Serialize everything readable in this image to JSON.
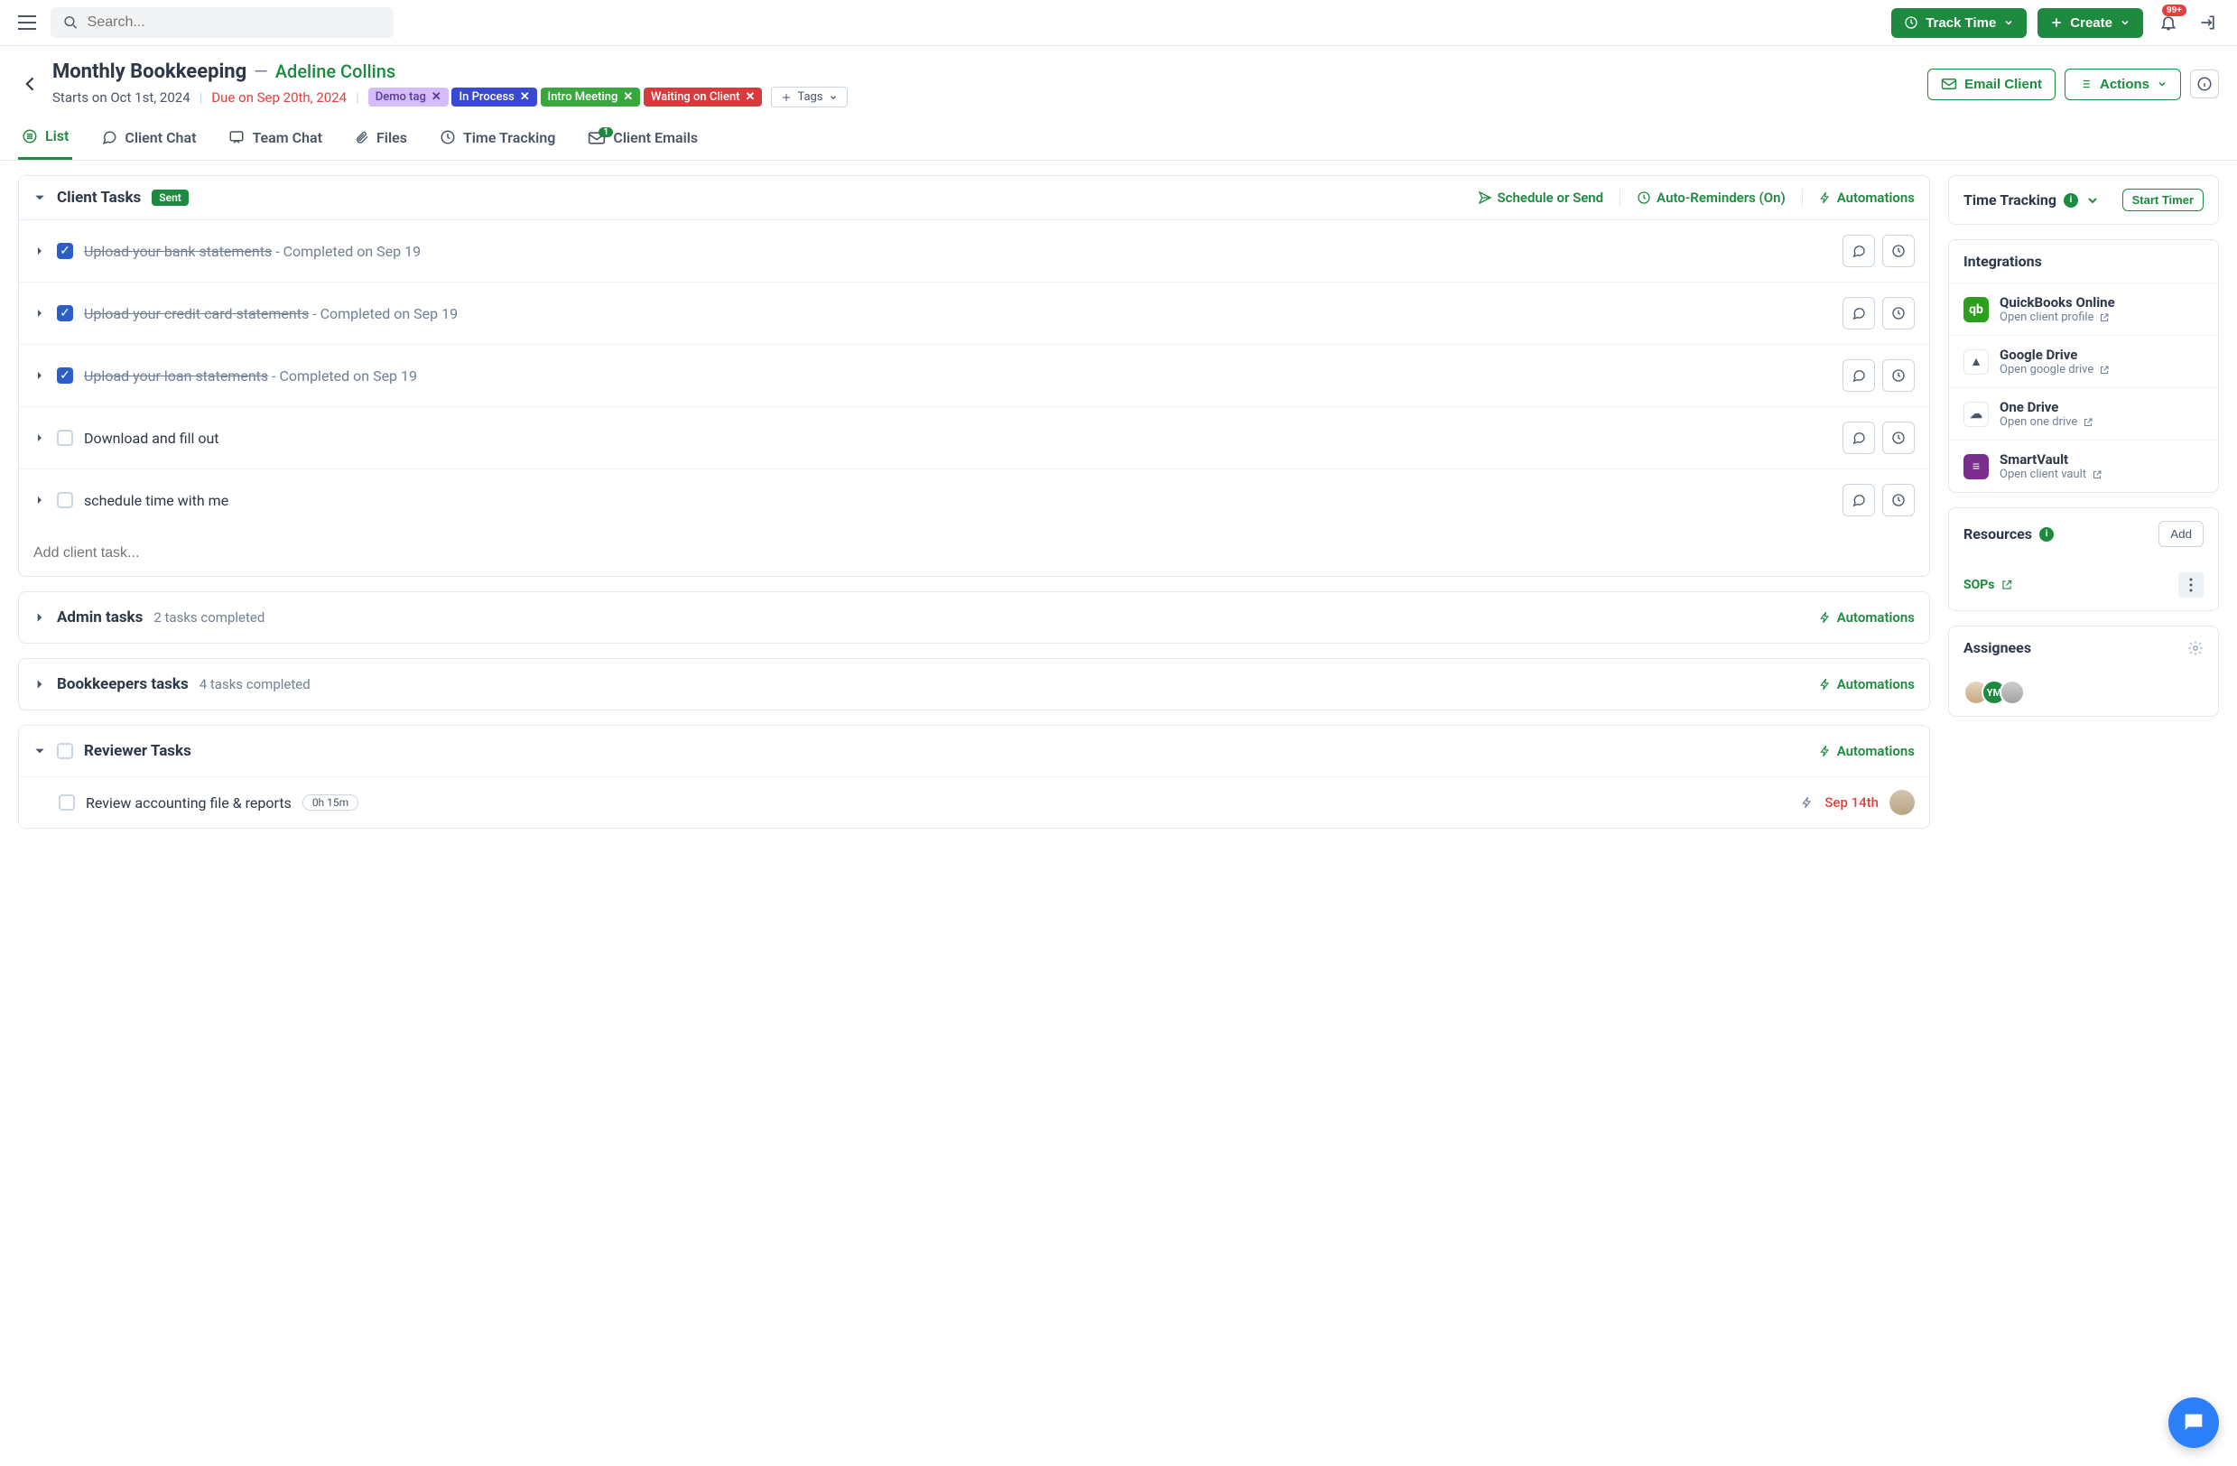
{
  "topbar": {
    "search_placeholder": "Search...",
    "track_time": "Track Time",
    "create": "Create",
    "notif_count": "99+"
  },
  "header": {
    "title": "Monthly Bookkeeping",
    "client": "Adeline Collins",
    "starts": "Starts on Oct 1st, 2024",
    "due": "Due on Sep 20th, 2024",
    "tags": [
      {
        "label": "Demo tag",
        "cls": "tag-purple"
      },
      {
        "label": "In Process",
        "cls": "tag-blue"
      },
      {
        "label": "Intro Meeting",
        "cls": "tag-green"
      },
      {
        "label": "Waiting on Client",
        "cls": "tag-red"
      }
    ],
    "tags_btn": "Tags",
    "email_client": "Email Client",
    "actions": "Actions"
  },
  "tabs": {
    "list": "List",
    "client_chat": "Client Chat",
    "team_chat": "Team Chat",
    "files": "Files",
    "time_tracking": "Time Tracking",
    "client_emails": "Client Emails",
    "emails_badge": "1"
  },
  "client_tasks": {
    "title": "Client Tasks",
    "sent": "Sent",
    "schedule": "Schedule or Send",
    "reminders": "Auto-Reminders (On)",
    "automations": "Automations",
    "items": [
      {
        "name": "Upload your bank statements",
        "done": true,
        "completed": "Completed on Sep 19"
      },
      {
        "name": "Upload your credit card statements",
        "done": true,
        "completed": "Completed on Sep 19"
      },
      {
        "name": "Upload your loan statements",
        "done": true,
        "completed": "Completed on Sep 19"
      },
      {
        "name": "Download and fill out",
        "done": false
      },
      {
        "name": "schedule time with me",
        "done": false
      }
    ],
    "add_placeholder": "Add client task..."
  },
  "admin_tasks": {
    "title": "Admin tasks",
    "meta": "2 tasks completed",
    "automations": "Automations"
  },
  "bookkeeper_tasks": {
    "title": "Bookkeepers tasks",
    "meta": "4 tasks completed",
    "automations": "Automations"
  },
  "reviewer_tasks": {
    "title": "Reviewer Tasks",
    "automations": "Automations",
    "task_name": "Review accounting file & reports",
    "time": "0h 15m",
    "due": "Sep 14th"
  },
  "tt": {
    "title": "Time Tracking",
    "start": "Start Timer"
  },
  "integ": {
    "title": "Integrations",
    "items": [
      {
        "name": "QuickBooks Online",
        "sub": "Open client profile",
        "bg": "#2ca01c",
        "txt": "qb"
      },
      {
        "name": "Google Drive",
        "sub": "Open google drive",
        "bg": "#fff",
        "txt": "▲"
      },
      {
        "name": "One Drive",
        "sub": "Open one drive",
        "bg": "#fff",
        "txt": "☁"
      },
      {
        "name": "SmartVault",
        "sub": "Open client vault",
        "bg": "#7b2e8e",
        "txt": "≡"
      }
    ]
  },
  "resources": {
    "title": "Resources",
    "add": "Add",
    "sops": "SOPs"
  },
  "assignees": {
    "title": "Assignees"
  }
}
